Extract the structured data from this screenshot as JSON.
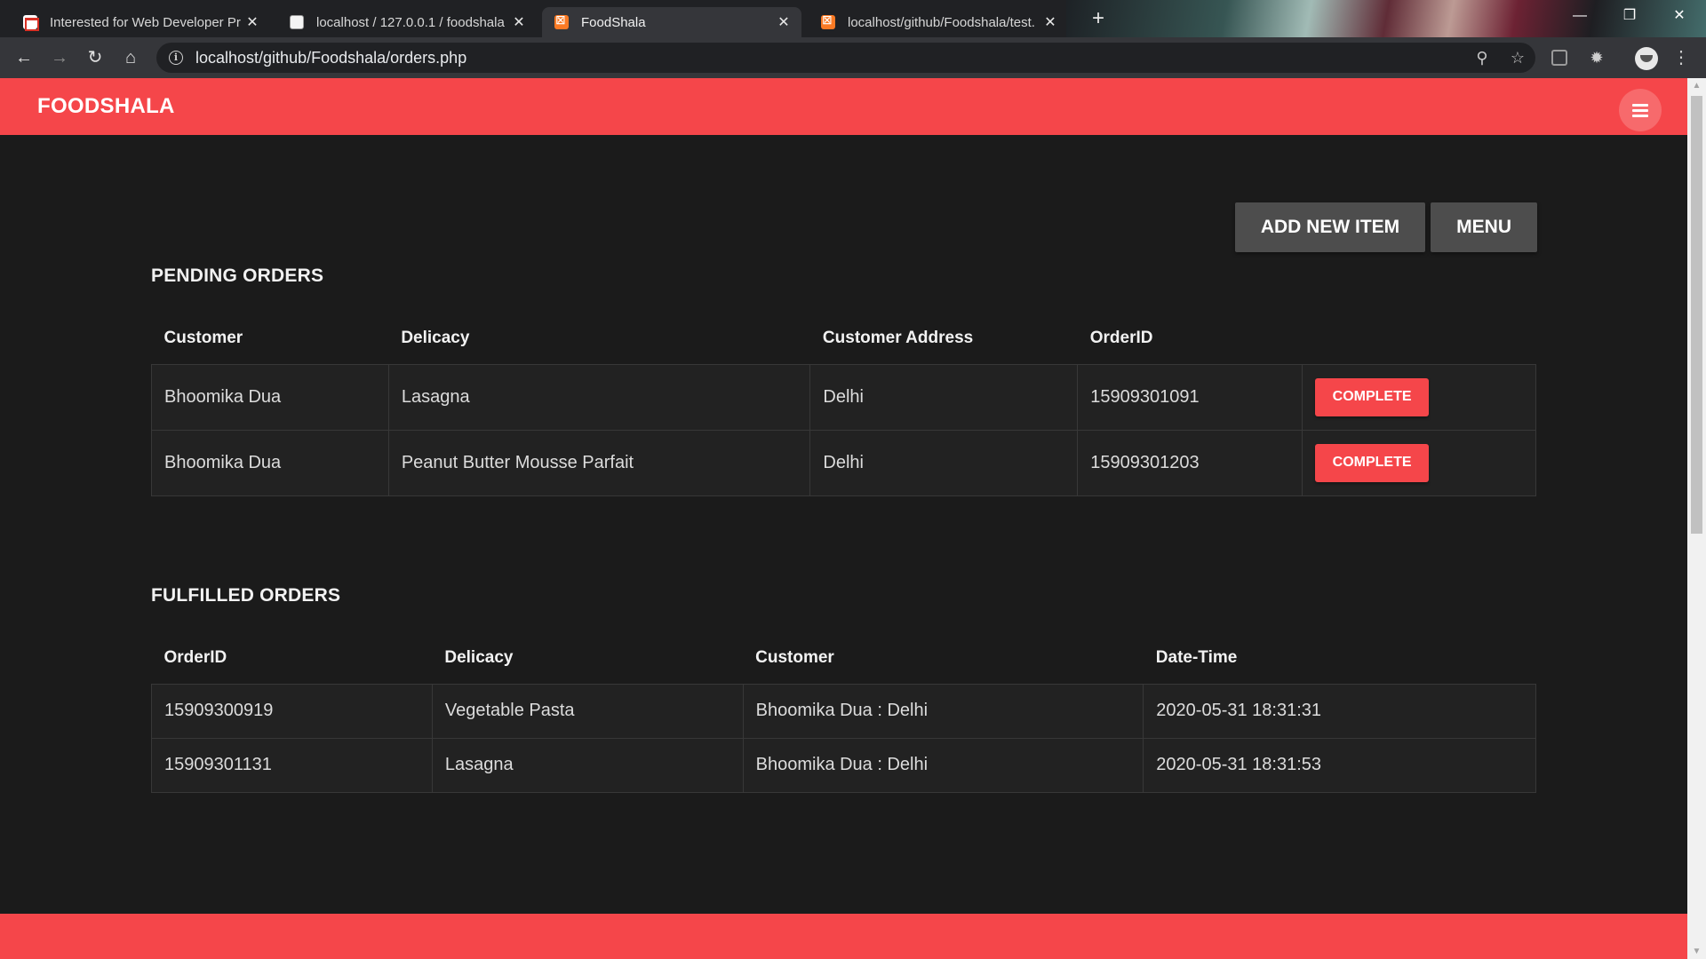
{
  "browser": {
    "tabs": [
      {
        "title": "Interested for Web Developer Pr",
        "favicon": "gmail-icon",
        "active": false
      },
      {
        "title": "localhost / 127.0.0.1 / foodshala",
        "favicon": "phpmyadmin-icon",
        "active": false
      },
      {
        "title": "FoodShala",
        "favicon": "xampp-icon",
        "active": true
      },
      {
        "title": "localhost/github/Foodshala/test.",
        "favicon": "xampp-icon",
        "active": false
      }
    ],
    "new_tab": "+",
    "window_controls": {
      "minimize": "—",
      "restore": "❐",
      "close": "✕"
    },
    "nav": {
      "back": "←",
      "forward": "→",
      "reload": "↻",
      "home": "⌂"
    },
    "url": "localhost/github/Foodshala/orders.php",
    "omnibox_icons": {
      "zoom": "⚲",
      "bookmark": "☆"
    },
    "menu": "⋮"
  },
  "app": {
    "brand": "FOODSHALA",
    "colors": {
      "accent": "#f5464a",
      "background": "#1b1b1b",
      "button_grey": "#4d4d4d"
    },
    "actions": {
      "add_new_item": "ADD NEW ITEM",
      "menu": "MENU"
    }
  },
  "pending": {
    "title": "PENDING ORDERS",
    "headers": [
      "Customer",
      "Delicacy",
      "Customer Address",
      "OrderID",
      ""
    ],
    "rows": [
      {
        "customer": "Bhoomika Dua",
        "delicacy": "Lasagna",
        "address": "Delhi",
        "order_id": "15909301091",
        "action": "COMPLETE"
      },
      {
        "customer": "Bhoomika Dua",
        "delicacy": "Peanut Butter Mousse Parfait",
        "address": "Delhi",
        "order_id": "15909301203",
        "action": "COMPLETE"
      }
    ]
  },
  "fulfilled": {
    "title": "FULFILLED ORDERS",
    "headers": [
      "OrderID",
      "Delicacy",
      "Customer",
      "Date-Time"
    ],
    "rows": [
      {
        "order_id": "15909300919",
        "delicacy": "Vegetable Pasta",
        "customer": "Bhoomika Dua : Delhi",
        "datetime": "2020-05-31 18:31:31"
      },
      {
        "order_id": "15909301131",
        "delicacy": "Lasagna",
        "customer": "Bhoomika Dua : Delhi",
        "datetime": "2020-05-31 18:31:53"
      }
    ]
  }
}
